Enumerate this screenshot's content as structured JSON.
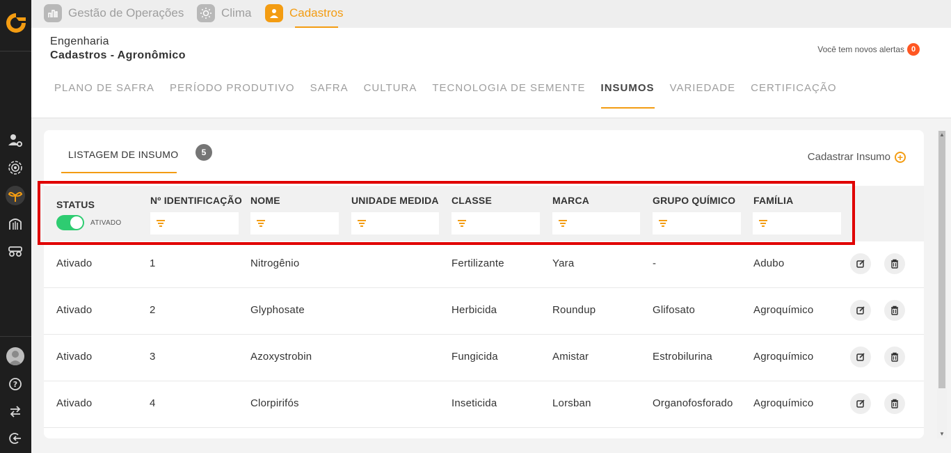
{
  "top_nav": [
    {
      "label": "Gestão de Operações",
      "icon": "operations-icon",
      "active": false
    },
    {
      "label": "Clima",
      "icon": "sun-icon",
      "active": false
    },
    {
      "label": "Cadastros",
      "icon": "user-icon",
      "active": true
    }
  ],
  "header": {
    "breadcrumb_parent": "Engenharia",
    "page_title": "Cadastros - Agronômico",
    "alerts_text": "Você tem novos alertas",
    "alerts_count": "0"
  },
  "tabs": [
    {
      "label": "PLANO DE SAFRA",
      "active": false
    },
    {
      "label": "PERÍODO PRODUTIVO",
      "active": false
    },
    {
      "label": "SAFRA",
      "active": false
    },
    {
      "label": "CULTURA",
      "active": false
    },
    {
      "label": "TECNOLOGIA DE SEMENTE",
      "active": false
    },
    {
      "label": "INSUMOS",
      "active": true
    },
    {
      "label": "VARIEDADE",
      "active": false
    },
    {
      "label": "CERTIFICAÇÃO",
      "active": false
    }
  ],
  "listing": {
    "title": "LISTAGEM DE INSUMO",
    "count": "5",
    "add_label": "Cadastrar Insumo"
  },
  "filters": {
    "status_header": "STATUS",
    "status_toggle_label": "ATIVADO",
    "status_on": true,
    "columns": [
      "Nº IDENTIFICAÇÃO",
      "NOME",
      "UNIDADE MEDIDA",
      "CLASSE",
      "MARCA",
      "GRUPO QUÍMICO",
      "FAMÍLIA"
    ]
  },
  "rows": [
    {
      "status": "Ativado",
      "id": "1",
      "nome": "Nitrogênio",
      "unidade": "",
      "classe": "Fertilizante",
      "marca": "Yara",
      "grupo": "-",
      "familia": "Adubo"
    },
    {
      "status": "Ativado",
      "id": "2",
      "nome": "Glyphosate",
      "unidade": "",
      "classe": "Herbicida",
      "marca": "Roundup",
      "grupo": "Glifosato",
      "familia": "Agroquímico"
    },
    {
      "status": "Ativado",
      "id": "3",
      "nome": "Azoxystrobin",
      "unidade": "",
      "classe": "Fungicida",
      "marca": "Amistar",
      "grupo": "Estrobilurina",
      "familia": "Agroquímico"
    },
    {
      "status": "Ativado",
      "id": "4",
      "nome": "Clorpirifós",
      "unidade": "",
      "classe": "Inseticida",
      "marca": "Lorsban",
      "grupo": "Organofosforado",
      "familia": "Agroquímico"
    }
  ],
  "colors": {
    "accent": "#f39c12",
    "toggle_on": "#2ecc71",
    "highlight": "#e00000",
    "sidebar": "#1e1e1e"
  }
}
